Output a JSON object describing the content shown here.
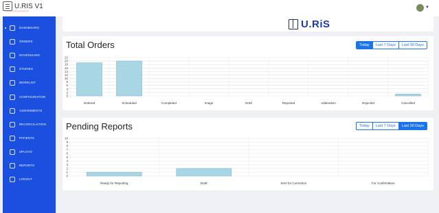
{
  "app": {
    "title": "U.RIS V1",
    "subtitle": "•••••••••••••••",
    "logo_text": "U.RiS"
  },
  "sidebar": {
    "items": [
      {
        "label": "DASHBOARD",
        "icon": "dashboard-icon",
        "active": true
      },
      {
        "label": "ORDERS",
        "icon": "orders-icon"
      },
      {
        "label": "SCHEDULING",
        "icon": "calendar-icon"
      },
      {
        "label": "STUDIES",
        "icon": "studies-icon"
      },
      {
        "label": "WORKLIST",
        "icon": "worklist-icon"
      },
      {
        "label": "CONFIGURATION",
        "icon": "configuration-icon"
      },
      {
        "label": "ASSIGNMENTS",
        "icon": "assignments-icon"
      },
      {
        "label": "RECONCILIATION",
        "icon": "link-icon"
      },
      {
        "label": "PATIENTS",
        "icon": "patients-icon"
      },
      {
        "label": "UPLOAD",
        "icon": "upload-icon"
      },
      {
        "label": "REPORTS",
        "icon": "reports-icon"
      },
      {
        "label": "LOGOUT",
        "icon": "logout-icon"
      }
    ]
  },
  "total_orders": {
    "title": "Total Orders",
    "filters": [
      "Today",
      "Last 7 Days",
      "Last 30 Days"
    ],
    "active_filter": "Today"
  },
  "pending_reports": {
    "title": "Pending Reports",
    "filters": [
      "Today",
      "Last 7 Days",
      "Last 30 Days"
    ],
    "active_filter": "Last 30 Days"
  },
  "colors": {
    "sidebar": "#1a4fe0",
    "accent": "#1a73e8",
    "bar_fill": "#a9d6e5",
    "bar_stroke": "#7fb6cc"
  },
  "chart_data": [
    {
      "type": "bar",
      "categories": [
        "Ordered",
        "Scheduled",
        "Completed",
        "Image",
        "Draft",
        "Reported",
        "Addendum",
        "Rejected",
        "Cancelled"
      ],
      "values": [
        19,
        20,
        0,
        0,
        0,
        0,
        0,
        0,
        1
      ],
      "yticks": [
        0,
        2,
        4,
        6,
        8,
        10,
        12,
        14,
        16,
        18,
        20,
        22
      ],
      "ylim": [
        0,
        22
      ],
      "grid": true
    },
    {
      "type": "bar",
      "categories": [
        "Ready for Reporting",
        "Draft",
        "Sent for Correction",
        "For Confirmation"
      ],
      "values": [
        1,
        2,
        0,
        0
      ],
      "yticks": [
        0,
        1,
        2,
        3,
        4,
        5,
        6,
        7,
        8,
        9,
        10
      ],
      "ylim": [
        0,
        10
      ],
      "grid": true
    }
  ]
}
